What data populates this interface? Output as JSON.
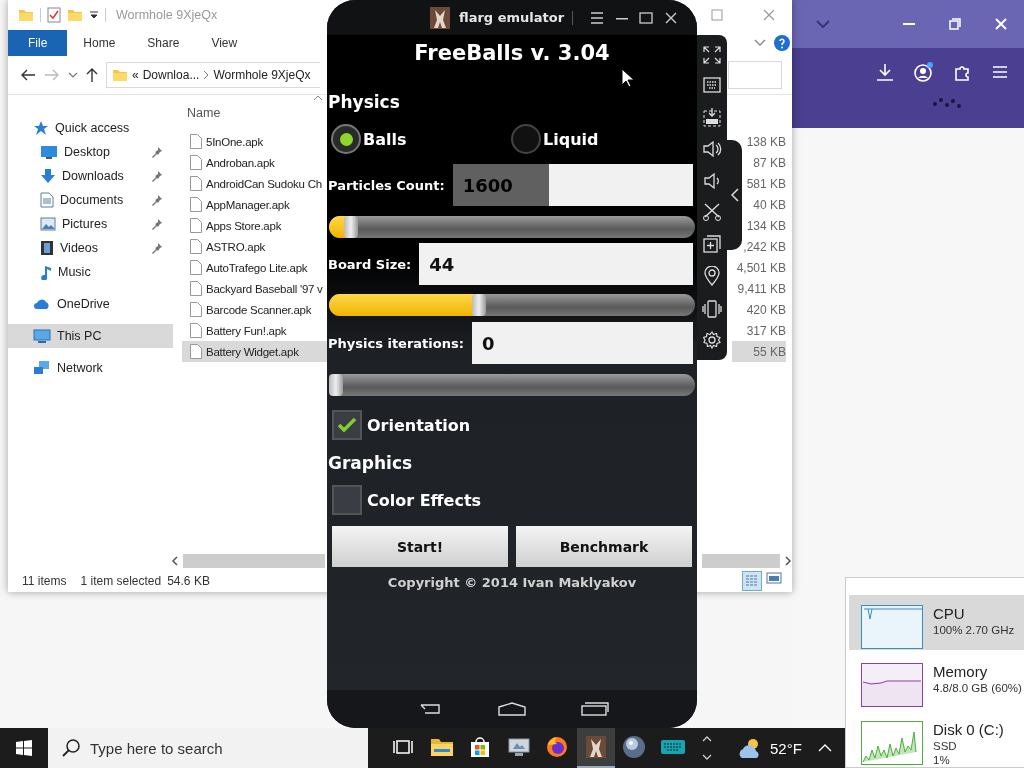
{
  "explorer": {
    "title": "Wormhole 9XjeQx",
    "ribbon_tabs": [
      {
        "label": "File",
        "selected": true
      },
      {
        "label": "Home",
        "selected": false
      },
      {
        "label": "Share",
        "selected": false
      },
      {
        "label": "View",
        "selected": false
      }
    ],
    "address": {
      "overflow_mark": "«",
      "crumbs": [
        "Downloa...",
        "Wormhole 9XjeQx"
      ]
    },
    "navigation": [
      {
        "label": "Quick access",
        "kind": "star",
        "selected": false,
        "children": [
          {
            "label": "Desktop",
            "kind": "desktop",
            "pinned": true,
            "selected": false
          },
          {
            "label": "Downloads",
            "kind": "download",
            "pinned": true,
            "selected": false
          },
          {
            "label": "Documents",
            "kind": "document",
            "pinned": true,
            "selected": false
          },
          {
            "label": "Pictures",
            "kind": "picture",
            "pinned": true,
            "selected": false
          },
          {
            "label": "Videos",
            "kind": "video",
            "pinned": true,
            "selected": false
          },
          {
            "label": "Music",
            "kind": "music",
            "pinned": false,
            "selected": false
          }
        ]
      },
      {
        "label": "OneDrive",
        "kind": "cloud",
        "selected": false
      },
      {
        "label": "This PC",
        "kind": "pc",
        "selected": true
      },
      {
        "label": "Network",
        "kind": "network",
        "selected": false
      }
    ],
    "column": "Name",
    "files": [
      {
        "name": "5InOne.apk",
        "size": "138 KB",
        "selected": false
      },
      {
        "name": "Androban.apk",
        "size": "87 KB",
        "selected": false
      },
      {
        "name": "AndroidCan Sudoku Ch",
        "size": "581 KB",
        "selected": false
      },
      {
        "name": "AppManager.apk",
        "size": "40 KB",
        "selected": false
      },
      {
        "name": "Apps Store.apk",
        "size": "134 KB",
        "selected": false
      },
      {
        "name": "ASTRO.apk",
        "size": ",242 KB",
        "selected": false
      },
      {
        "name": "AutoTrafego Lite.apk",
        "size": "4,501 KB",
        "selected": false
      },
      {
        "name": "Backyard Baseball '97 v",
        "size": "9,411 KB",
        "selected": false
      },
      {
        "name": "Barcode Scanner.apk",
        "size": "420 KB",
        "selected": false
      },
      {
        "name": "Battery Fun!.apk",
        "size": "317 KB",
        "selected": false
      },
      {
        "name": "Battery Widget.apk",
        "size": "55 KB",
        "selected": true
      }
    ],
    "status": {
      "count": "11 items",
      "selection": "1 item selected",
      "selection_size": "54.6 KB"
    }
  },
  "emulator": {
    "title": "flarg emulator",
    "app": {
      "title": "FreeBalls v. 3.04",
      "physics_heading": "Physics",
      "modes": [
        {
          "label": "Balls",
          "selected": true
        },
        {
          "label": "Liquid",
          "selected": false
        }
      ],
      "fields": [
        {
          "label": "Particles Count:",
          "value": "1600",
          "level": 0.06
        },
        {
          "label": "Board Size:",
          "value": "44",
          "level": 0.41
        },
        {
          "label": "Physics iterations:",
          "value": "0",
          "level": 0
        }
      ],
      "physics_options": [
        {
          "label": "Orientation",
          "checked": true
        }
      ],
      "graphics_heading": "Graphics",
      "graphics_options": [
        {
          "label": "Color Effects",
          "checked": false
        }
      ],
      "buttons": [
        "Start!",
        "Benchmark"
      ],
      "copyright": "Copyright © 2014 Ivan Maklyakov"
    }
  },
  "task_manager": {
    "resources": [
      {
        "name": "CPU",
        "details": [
          "100% 2.70 GHz"
        ],
        "color": "#3c8dbc",
        "selected": true
      },
      {
        "name": "Memory",
        "details": [
          "4.8/8.0 GB (60%)"
        ],
        "color": "#8b3fa0",
        "selected": false
      },
      {
        "name": "Disk 0 (C:)",
        "details": [
          "SSD",
          "1%"
        ],
        "color": "#4caf3a",
        "selected": false
      }
    ]
  },
  "taskbar": {
    "search_placeholder": "Type here to search",
    "apps": [
      {
        "kind": "taskview",
        "selected": false
      },
      {
        "kind": "folder",
        "selected": false
      },
      {
        "kind": "store",
        "selected": false
      },
      {
        "kind": "monitor",
        "selected": false
      },
      {
        "kind": "browser",
        "selected": false
      },
      {
        "kind": "emulator",
        "selected": true
      },
      {
        "kind": "sphere",
        "selected": false
      },
      {
        "kind": "keyboard",
        "selected": false
      }
    ],
    "weather": "52°F"
  }
}
